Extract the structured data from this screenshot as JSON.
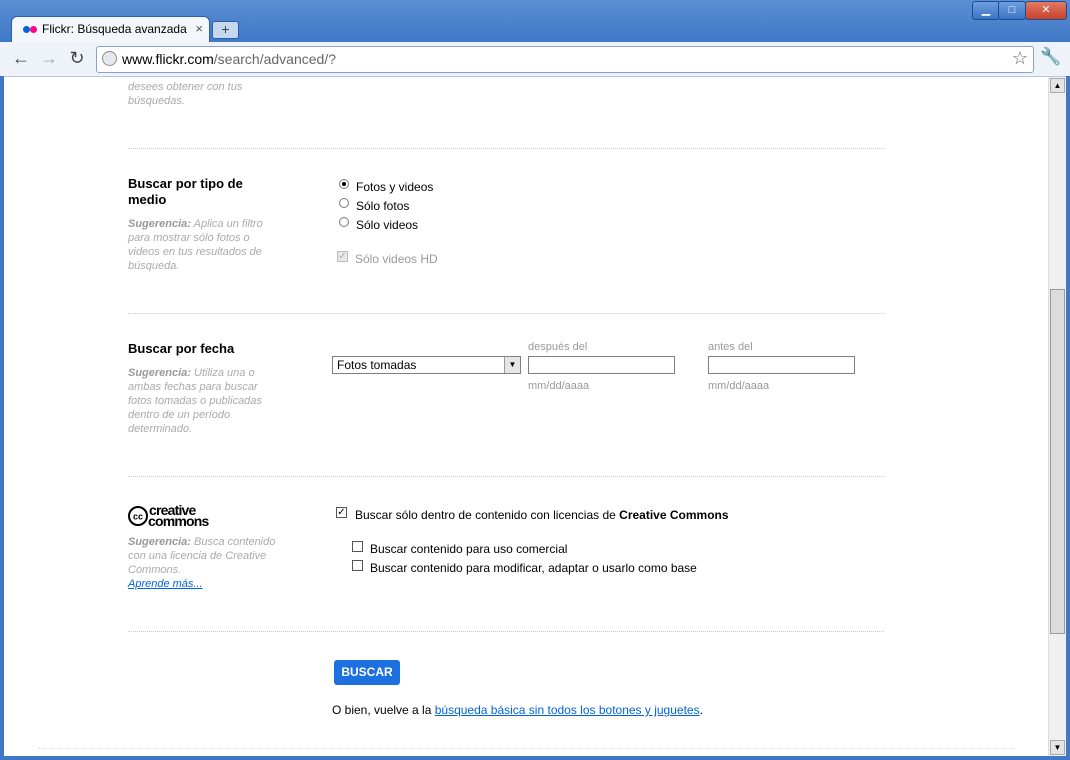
{
  "browser": {
    "tab_title": "Flickr: Búsqueda avanzada",
    "tab_close": "×",
    "new_tab": "+",
    "url_host": "www.flickr.com",
    "url_path": "/search/advanced/?",
    "back_glyph": "←",
    "forward_glyph": "→",
    "reload_glyph": "↻",
    "star_glyph": "☆",
    "wrench_glyph": "🔧",
    "minimize": "▁",
    "maximize": "□",
    "close": "✕"
  },
  "top_partial_hint": [
    "desees obtener con tus",
    "búsquedas."
  ],
  "media_type": {
    "heading": "Buscar por tipo de medio",
    "hint_label": "Sugerencia:",
    "hint_text": "Aplica un filtro para mostrar sólo fotos o videos en tus resultados de búsqueda.",
    "options": [
      "Fotos y videos",
      "Sólo fotos",
      "Sólo videos"
    ],
    "selected": 0,
    "hd_label": "Sólo videos HD"
  },
  "date": {
    "heading": "Buscar por fecha",
    "hint_label": "Sugerencia:",
    "hint_text": "Utiliza una o ambas fechas para buscar fotos tomadas o publicadas dentro de un período determinado.",
    "select_value": "Fotos tomadas",
    "after_label": "después del",
    "before_label": "antes del",
    "format": "mm/dd/aaaa"
  },
  "cc": {
    "logo_text_top": "creative",
    "logo_text_bottom": "commons",
    "logo_badge": "cc",
    "hint_label": "Sugerencia:",
    "hint_text": "Busca contenido con una licencia de Creative Commons.",
    "learn_more": "Aprende más...",
    "main_check_prefix": "Buscar sólo dentro de contenido con licencias de ",
    "main_check_bold": "Creative Commons",
    "main_checked": true,
    "commercial": "Buscar contenido para uso comercial",
    "modify": "Buscar contenido para modificar, adaptar o usarlo como base"
  },
  "search_button": "BUSCAR",
  "footer": {
    "prefix": "O bien, vuelve a la ",
    "link": "búsqueda básica sin todos los botones y juguetes",
    "suffix": "."
  }
}
